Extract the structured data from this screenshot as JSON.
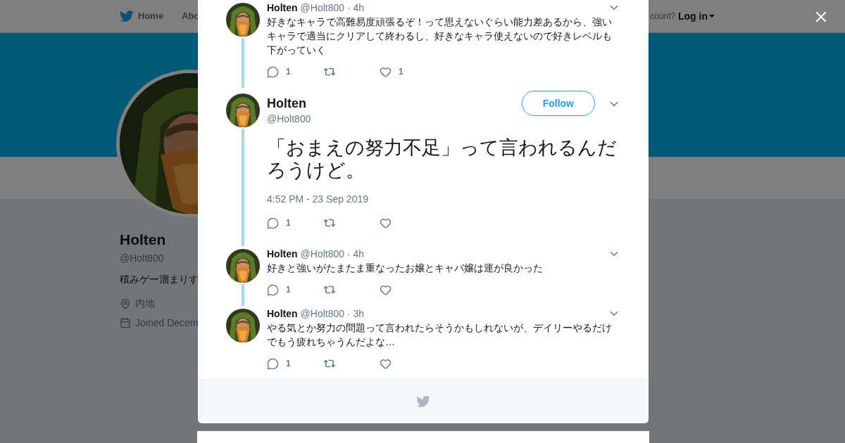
{
  "top_nav": {
    "items": [
      {
        "label": "Home",
        "selected": false
      },
      {
        "label": "Abo",
        "selected": false
      }
    ],
    "account_prompt": "count?",
    "login": "Log in"
  },
  "profile": {
    "name": "Holten",
    "handle": "@Holt800",
    "bio": "積みゲー溜まりす",
    "location": "内地",
    "joined": "Joined Decem"
  },
  "tweets": [
    {
      "kind": "reply",
      "name": "Holten",
      "handle": "@Holt800",
      "time": "· 4h",
      "text": "好きなキャラで高難易度頑張るぞ！って思えないぐらい能力差あるから、強いキャラで適当にクリアして終わるし、好きなキャラ使えないので好きレベルも下がっていく",
      "replies": "1",
      "likes": "1",
      "thread_below": true
    },
    {
      "kind": "main",
      "name": "Holten",
      "handle": "@Holt800",
      "follow": "Follow",
      "text": "「おまえの努力不足」って言われるんだろうけど。",
      "date": "4:52 PM - 23 Sep 2019",
      "replies": "1",
      "thread_below": true
    },
    {
      "kind": "reply",
      "name": "Holten",
      "handle": "@Holt800",
      "time": "· 4h",
      "text": "好きと強いがたまたま重なったお嬢とキャバ嬢は運が良かった",
      "replies": "1",
      "thread_below": true
    },
    {
      "kind": "reply",
      "name": "Holten",
      "handle": "@Holt800",
      "time": "· 3h",
      "text": "やる気とか努力の問題って言われたらそうかもしれないが、デイリーやるだけでもう疲れちゃうんだよな…",
      "replies": "1",
      "thread_below": false
    }
  ]
}
